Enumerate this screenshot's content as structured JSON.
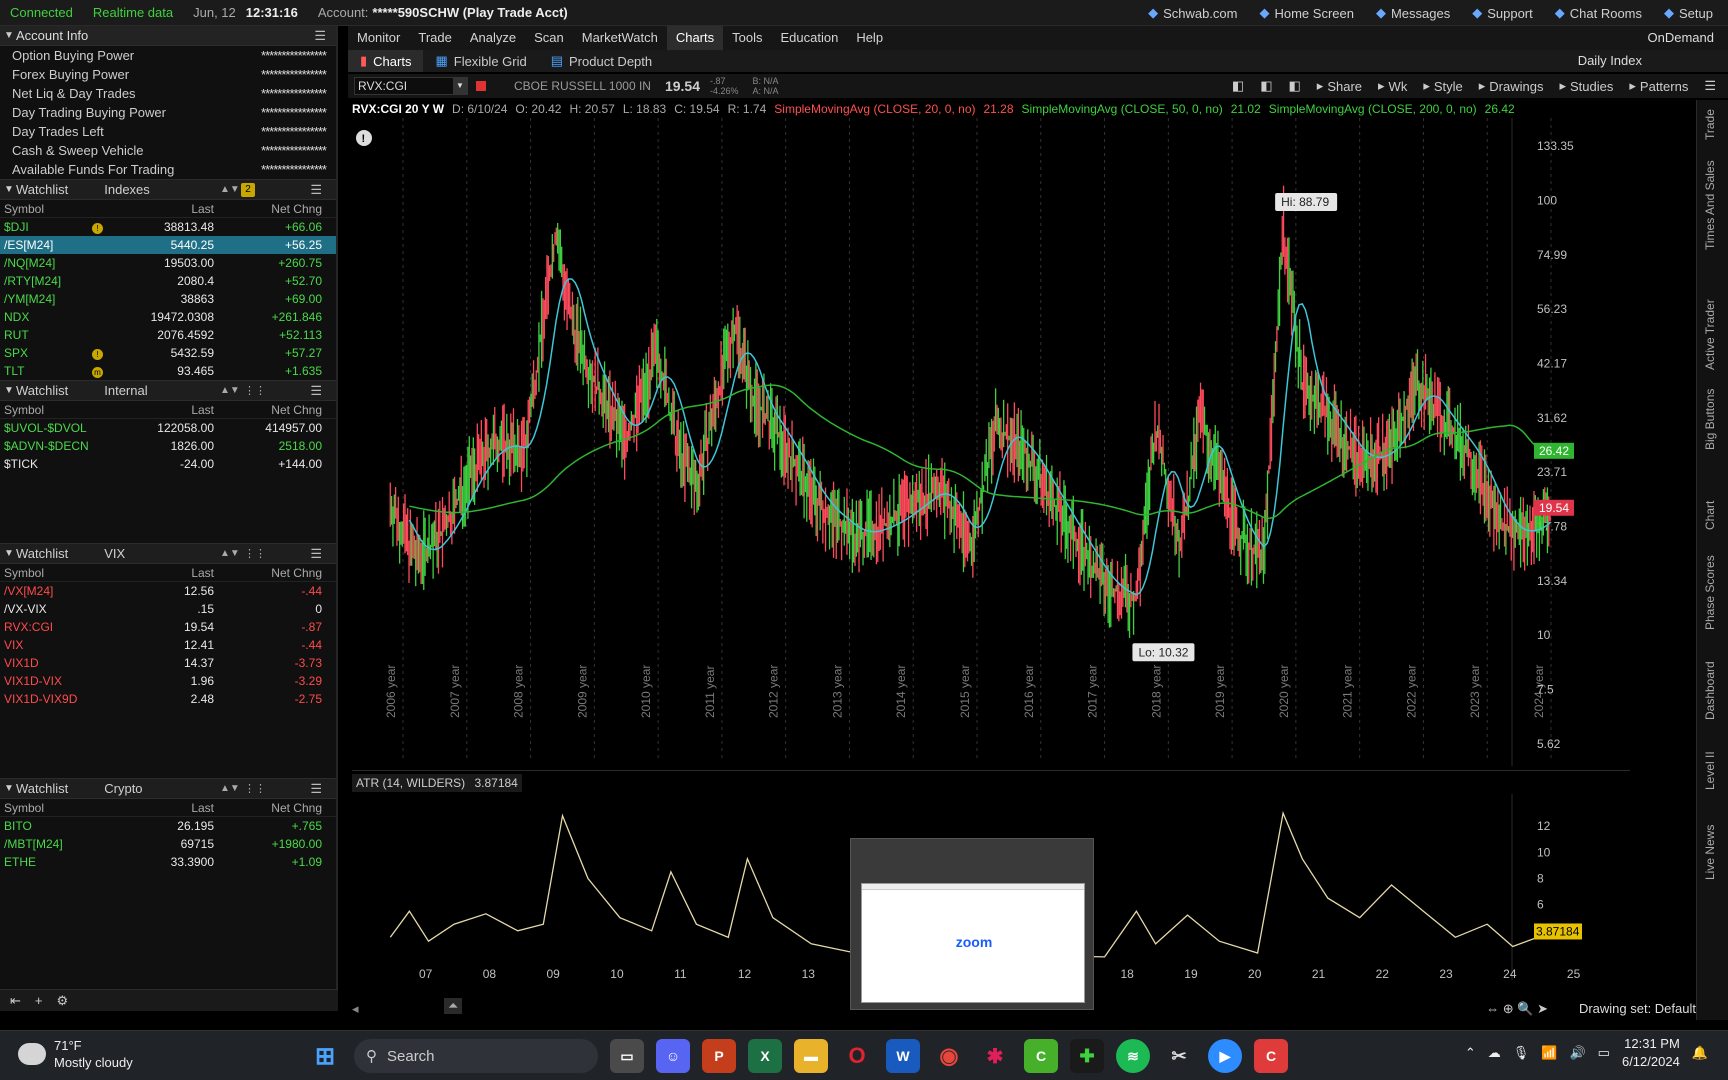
{
  "status": {
    "connected": "Connected",
    "realtime": "Realtime data",
    "date": "Jun, 12",
    "time": "12:31:16",
    "account_label": "Account:",
    "account": "*****590SCHW (Play Trade Acct)"
  },
  "toplinks": [
    {
      "label": "Schwab.com",
      "icon": "external-link-icon"
    },
    {
      "label": "Home Screen",
      "icon": "home-icon"
    },
    {
      "label": "Messages",
      "icon": "mail-icon"
    },
    {
      "label": "Support",
      "icon": "headset-icon"
    },
    {
      "label": "Chat Rooms",
      "icon": "chat-icon"
    },
    {
      "label": "Setup",
      "icon": "gear-icon"
    }
  ],
  "menu": {
    "items": [
      "Monitor",
      "Trade",
      "Analyze",
      "Scan",
      "MarketWatch",
      "Charts",
      "Tools",
      "Education",
      "Help"
    ],
    "active": "Charts",
    "ondemand": "OnDemand"
  },
  "account_info": {
    "title": "Account Info",
    "rows": [
      {
        "label": "Option Buying Power",
        "value": "****************"
      },
      {
        "label": "Forex Buying Power",
        "value": "****************"
      },
      {
        "label": "Net Liq & Day Trades",
        "value": "****************"
      },
      {
        "label": "Day Trading Buying Power",
        "value": "****************"
      },
      {
        "label": "Day Trades Left",
        "value": "****************"
      },
      {
        "label": "Cash & Sweep Vehicle",
        "value": "****************"
      },
      {
        "label": "Available Funds For Trading",
        "value": "****************"
      }
    ]
  },
  "watchlists": [
    {
      "label": "Watchlist",
      "name": "Indexes",
      "cols": [
        "Symbol",
        "Last",
        "Net Chng"
      ],
      "rows": [
        {
          "sym": "$DJI",
          "last": "38813.48",
          "chg": "+66.06",
          "symc": "sym-green",
          "chgc": "pos",
          "dot": "!"
        },
        {
          "sym": "/ES[M24]",
          "last": "5440.25",
          "chg": "+56.25",
          "symc": "sym-white",
          "chgc": "pos",
          "sel": true
        },
        {
          "sym": "/NQ[M24]",
          "last": "19503.00",
          "chg": "+260.75",
          "symc": "sym-green",
          "chgc": "pos"
        },
        {
          "sym": "/RTY[M24]",
          "last": "2080.4",
          "chg": "+52.70",
          "symc": "sym-green",
          "chgc": "pos"
        },
        {
          "sym": "/YM[M24]",
          "last": "38863",
          "chg": "+69.00",
          "symc": "sym-green",
          "chgc": "pos"
        },
        {
          "sym": "NDX",
          "last": "19472.0308",
          "chg": "+261.846",
          "symc": "sym-green",
          "chgc": "pos"
        },
        {
          "sym": "RUT",
          "last": "2076.4592",
          "chg": "+52.113",
          "symc": "sym-green",
          "chgc": "pos"
        },
        {
          "sym": "SPX",
          "last": "5432.59",
          "chg": "+57.27",
          "symc": "sym-green",
          "chgc": "pos",
          "dot": "!"
        },
        {
          "sym": "TLT",
          "last": "93.465",
          "chg": "+1.635",
          "symc": "sym-green",
          "chgc": "pos",
          "dot": "m"
        }
      ]
    },
    {
      "label": "Watchlist",
      "name": "Internal",
      "cols": [
        "Symbol",
        "Last",
        "Net Chng"
      ],
      "rows": [
        {
          "sym": "$UVOL-$DVOL",
          "last": "122058.00",
          "chg": "414957.00",
          "symc": "sym-green",
          "chgc": "sym-white"
        },
        {
          "sym": "$ADVN-$DECN",
          "last": "1826.00",
          "chg": "2518.00",
          "symc": "sym-green",
          "chgc": "pos"
        },
        {
          "sym": "$TICK",
          "last": "-24.00",
          "chg": "+144.00",
          "symc": "sym-white",
          "chgc": "sym-white"
        }
      ]
    },
    {
      "label": "Watchlist",
      "name": "VIX",
      "cols": [
        "Symbol",
        "Last",
        "Net Chng"
      ],
      "rows": [
        {
          "sym": "/VX[M24]",
          "last": "12.56",
          "chg": "-.44",
          "symc": "sym-red",
          "chgc": "neg"
        },
        {
          "sym": "/VX-VIX",
          "last": ".15",
          "chg": "0",
          "symc": "sym-white",
          "chgc": "sym-white"
        },
        {
          "sym": "RVX:CGI",
          "last": "19.54",
          "chg": "-.87",
          "symc": "sym-red",
          "chgc": "neg"
        },
        {
          "sym": "VIX",
          "last": "12.41",
          "chg": "-.44",
          "symc": "sym-red",
          "chgc": "neg"
        },
        {
          "sym": "VIX1D",
          "last": "14.37",
          "chg": "-3.73",
          "symc": "sym-red",
          "chgc": "neg"
        },
        {
          "sym": "VIX1D-VIX",
          "last": "1.96",
          "chg": "-3.29",
          "symc": "sym-red",
          "chgc": "neg"
        },
        {
          "sym": "VIX1D-VIX9D",
          "last": "2.48",
          "chg": "-2.75",
          "symc": "sym-red",
          "chgc": "neg"
        }
      ]
    },
    {
      "label": "Watchlist",
      "name": "Crypto",
      "cols": [
        "Symbol",
        "Last",
        "Net Chng"
      ],
      "rows": [
        {
          "sym": "BITO",
          "last": "26.195",
          "chg": "+.765",
          "symc": "sym-green",
          "chgc": "pos"
        },
        {
          "sym": "/MBT[M24]",
          "last": "69715",
          "chg": "+1980.00",
          "symc": "sym-green",
          "chgc": "pos"
        },
        {
          "sym": "ETHE",
          "last": "33.3900",
          "chg": "+1.09",
          "symc": "sym-green",
          "chgc": "pos"
        }
      ]
    }
  ],
  "chart_tabs": {
    "items": [
      "Charts",
      "Flexible Grid",
      "Product Depth"
    ],
    "daily_index": "Daily Index"
  },
  "symbol_bar": {
    "symbol": "RVX:CGI",
    "description": "CBOE RUSSELL 1000 IN",
    "price": "19.54",
    "change": "-.87",
    "change_pct": "-4.26%",
    "bid": "B: N/A",
    "ask": "A: N/A",
    "tools": [
      "Share",
      "Wk",
      "Style",
      "Drawings",
      "Studies",
      "Patterns"
    ]
  },
  "study_line": {
    "sym": "RVX:CGI 20 Y W",
    "d": "D: 6/10/24",
    "o": "O: 20.42",
    "h": "H: 20.57",
    "l": "L: 18.83",
    "c": "C: 19.54",
    "r": "R: 1.74",
    "sma20": "SimpleMovingAvg (CLOSE, 20, 0, no)",
    "sma20v": "21.28",
    "sma50": "SimpleMovingAvg (CLOSE, 50, 0, no)",
    "sma50v": "21.02",
    "sma200": "SimpleMovingAvg (CLOSE, 200, 0, no)",
    "sma200v": "26.42"
  },
  "atr": {
    "label": "ATR (14, WILDERS)",
    "value": "3.87184"
  },
  "chart_data": {
    "type": "line",
    "title": "RVX:CGI 20 Y W",
    "scale": "log",
    "y_ticks": [
      133.35,
      100,
      74.99,
      56.23,
      42.17,
      31.62,
      23.71,
      17.78,
      13.34,
      10,
      7.5,
      5.62
    ],
    "ylim": [
      5.62,
      150
    ],
    "x_year_labels": [
      "2006 year",
      "2007 year",
      "2008 year",
      "2009 year",
      "2010 year",
      "2011 year",
      "2012 year",
      "2013 year",
      "2014 year",
      "2015 year",
      "2016 year",
      "2017 year",
      "2018 year",
      "2019 year",
      "2020 year",
      "2021 year",
      "2022 year",
      "2023 year",
      "2024 year"
    ],
    "x_ticks_bottom": [
      "07",
      "08",
      "09",
      "10",
      "11",
      "12",
      "13",
      "18",
      "19",
      "20",
      "21",
      "22",
      "23",
      "24",
      "25"
    ],
    "hi_label": "Hi: 88.79",
    "lo_label": "Lo: 10.32",
    "last_price": "19.54",
    "sma200_value": "26.42",
    "price_series": [
      {
        "x": 2006.2,
        "y": 20
      },
      {
        "x": 2006.6,
        "y": 15
      },
      {
        "x": 2007.0,
        "y": 17
      },
      {
        "x": 2007.5,
        "y": 24
      },
      {
        "x": 2007.9,
        "y": 28
      },
      {
        "x": 2008.3,
        "y": 26
      },
      {
        "x": 2008.8,
        "y": 85
      },
      {
        "x": 2009.0,
        "y": 55
      },
      {
        "x": 2009.4,
        "y": 38
      },
      {
        "x": 2009.9,
        "y": 28
      },
      {
        "x": 2010.4,
        "y": 45
      },
      {
        "x": 2010.7,
        "y": 27
      },
      {
        "x": 2011.0,
        "y": 22
      },
      {
        "x": 2011.6,
        "y": 52
      },
      {
        "x": 2011.9,
        "y": 35
      },
      {
        "x": 2012.4,
        "y": 27
      },
      {
        "x": 2012.9,
        "y": 20
      },
      {
        "x": 2013.5,
        "y": 17
      },
      {
        "x": 2014.0,
        "y": 18
      },
      {
        "x": 2014.8,
        "y": 22
      },
      {
        "x": 2015.3,
        "y": 16
      },
      {
        "x": 2015.7,
        "y": 30
      },
      {
        "x": 2016.1,
        "y": 27
      },
      {
        "x": 2016.8,
        "y": 18
      },
      {
        "x": 2017.4,
        "y": 13
      },
      {
        "x": 2017.9,
        "y": 12
      },
      {
        "x": 2018.2,
        "y": 30
      },
      {
        "x": 2018.6,
        "y": 16
      },
      {
        "x": 2018.9,
        "y": 32
      },
      {
        "x": 2019.5,
        "y": 17
      },
      {
        "x": 2019.9,
        "y": 15
      },
      {
        "x": 2020.2,
        "y": 88.79
      },
      {
        "x": 2020.5,
        "y": 38
      },
      {
        "x": 2020.9,
        "y": 32
      },
      {
        "x": 2021.4,
        "y": 25
      },
      {
        "x": 2021.9,
        "y": 27
      },
      {
        "x": 2022.3,
        "y": 38
      },
      {
        "x": 2022.8,
        "y": 30
      },
      {
        "x": 2023.2,
        "y": 25
      },
      {
        "x": 2023.6,
        "y": 18
      },
      {
        "x": 2024.0,
        "y": 17
      },
      {
        "x": 2024.4,
        "y": 19.54
      }
    ],
    "atr_y_ticks": [
      12,
      10,
      8,
      6
    ],
    "atr_series": [
      {
        "x": 2006.2,
        "y": 3.5
      },
      {
        "x": 2006.5,
        "y": 5.5
      },
      {
        "x": 2006.8,
        "y": 3.2
      },
      {
        "x": 2007.2,
        "y": 4.5
      },
      {
        "x": 2007.7,
        "y": 5.3
      },
      {
        "x": 2008.2,
        "y": 4.0
      },
      {
        "x": 2008.6,
        "y": 4.5
      },
      {
        "x": 2008.9,
        "y": 12.8
      },
      {
        "x": 2009.3,
        "y": 8.0
      },
      {
        "x": 2009.8,
        "y": 5.0
      },
      {
        "x": 2010.3,
        "y": 4.0
      },
      {
        "x": 2010.6,
        "y": 8.5
      },
      {
        "x": 2011.0,
        "y": 4.5
      },
      {
        "x": 2011.5,
        "y": 3.5
      },
      {
        "x": 2011.8,
        "y": 9.5
      },
      {
        "x": 2012.2,
        "y": 5.0
      },
      {
        "x": 2012.8,
        "y": 3.0
      },
      {
        "x": 2013.4,
        "y": 2.4
      },
      {
        "x": 2017.4,
        "y": 2.0
      },
      {
        "x": 2017.9,
        "y": 5.5
      },
      {
        "x": 2018.2,
        "y": 3.0
      },
      {
        "x": 2018.7,
        "y": 5.2
      },
      {
        "x": 2019.2,
        "y": 3.2
      },
      {
        "x": 2019.8,
        "y": 2.3
      },
      {
        "x": 2020.2,
        "y": 13.0
      },
      {
        "x": 2020.5,
        "y": 9.5
      },
      {
        "x": 2020.9,
        "y": 6.5
      },
      {
        "x": 2021.4,
        "y": 5.0
      },
      {
        "x": 2021.9,
        "y": 7.5
      },
      {
        "x": 2022.4,
        "y": 5.5
      },
      {
        "x": 2022.9,
        "y": 3.5
      },
      {
        "x": 2023.4,
        "y": 4.5
      },
      {
        "x": 2023.8,
        "y": 2.8
      },
      {
        "x": 2024.4,
        "y": 3.87184
      }
    ]
  },
  "chart_footer": {
    "drawing_set": "Drawing set: Default"
  },
  "right_strip": [
    "Trade",
    "Times And Sales",
    "Active Trader",
    "Big Buttons",
    "Chart",
    "Phase Scores",
    "Dashboard",
    "Level II",
    "Live News"
  ],
  "zoom_overlay": {
    "text": "zoom"
  },
  "taskbar": {
    "weather_temp": "71°F",
    "weather_desc": "Mostly cloudy",
    "search": "Search",
    "time": "12:31 PM",
    "date": "6/12/2024"
  },
  "colors": {
    "up": "#3fd13f",
    "down": "#ff4b5c",
    "sma20": "#3ec6d8",
    "sma200": "#2fb52f",
    "accent": "#1f6f86"
  }
}
